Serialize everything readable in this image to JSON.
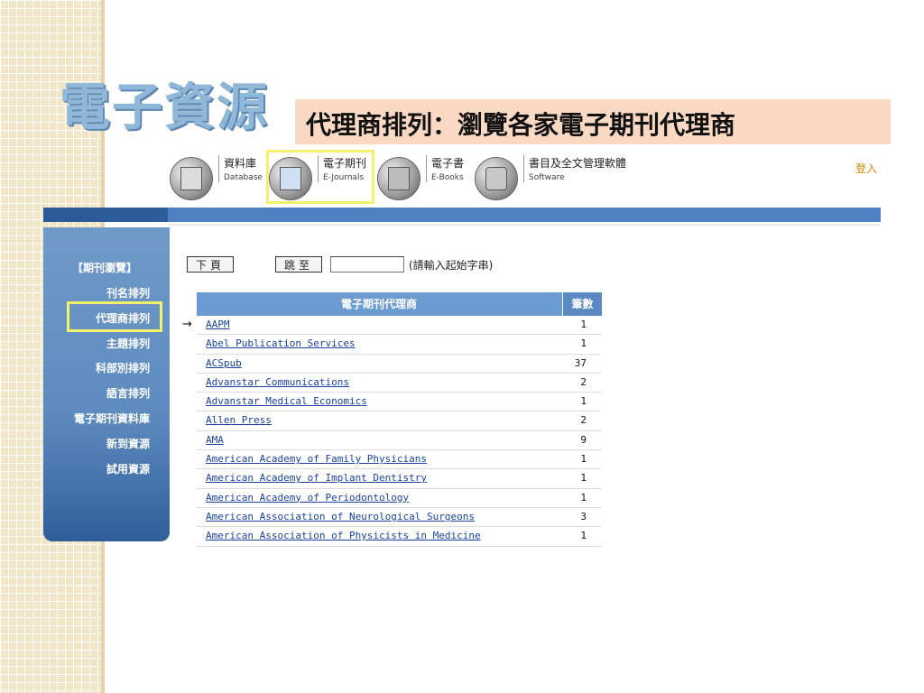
{
  "slide": {
    "title": "電子資源",
    "subtitle": "代理商排列：瀏覽各家電子期刊代理商"
  },
  "nav": {
    "items": [
      {
        "zh": "資料庫",
        "en": "Database",
        "icon": "database-icon"
      },
      {
        "zh": "電子期刊",
        "en": "E-Journals",
        "icon": "ejournals-icon"
      },
      {
        "zh": "電子書",
        "en": "E-Books",
        "icon": "ebooks-icon"
      },
      {
        "zh": "書目及全文管理軟體",
        "en": "Software",
        "icon": "software-icon"
      }
    ],
    "login": "登入"
  },
  "sidebar": {
    "header": "【期刊瀏覽】",
    "items": [
      "刊名排列",
      "代理商排列",
      "主題排列",
      "科部別排列",
      "語言排列",
      "電子期刊資料庫",
      "新到資源",
      "試用資源"
    ]
  },
  "controls": {
    "next_page": "下頁",
    "jump": "跳至",
    "hint": "(請輸入起始字串)",
    "arrow": "→"
  },
  "table": {
    "header_name": "電子期刊代理商",
    "header_count": "筆數",
    "rows": [
      {
        "name": "AAPM",
        "count": "1"
      },
      {
        "name": "Abel Publication Services",
        "count": "1"
      },
      {
        "name": "ACSpub",
        "count": "37"
      },
      {
        "name": "Advanstar Communications",
        "count": "2"
      },
      {
        "name": "Advanstar Medical Economics",
        "count": "1"
      },
      {
        "name": "Allen Press",
        "count": "2"
      },
      {
        "name": "AMA",
        "count": "9"
      },
      {
        "name": "American Academy of Family Physicians",
        "count": "1"
      },
      {
        "name": "American Academy of Implant Dentistry",
        "count": "1"
      },
      {
        "name": "American Academy of Periodontology",
        "count": "1"
      },
      {
        "name": "American Association of Neurological Surgeons",
        "count": "3"
      },
      {
        "name": "American Association of Physicists in Medicine",
        "count": "1"
      }
    ]
  },
  "colors": {
    "accent_blue": "#4f80c4",
    "highlight_yellow": "#f5f06a",
    "subtitle_bg": "#f9d9c4"
  }
}
